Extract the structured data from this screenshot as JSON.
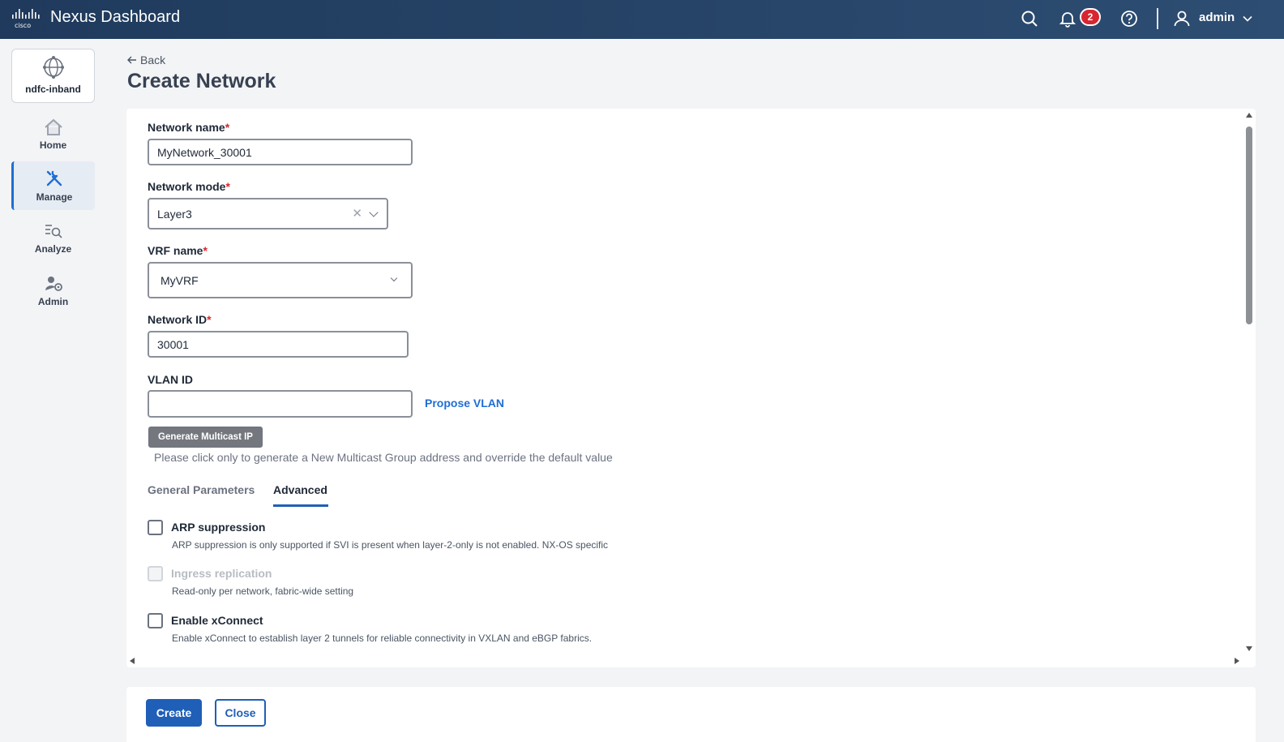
{
  "app": {
    "title": "Nexus Dashboard",
    "notification_count": "2",
    "user": "admin"
  },
  "sidebar": {
    "site": "ndfc-inband",
    "items": [
      {
        "label": "Home",
        "icon": "home-icon"
      },
      {
        "label": "Manage",
        "icon": "wrench-icon",
        "active": true
      },
      {
        "label": "Analyze",
        "icon": "analyze-icon"
      },
      {
        "label": "Admin",
        "icon": "admin-icon"
      }
    ]
  },
  "header": {
    "back_label": "Back",
    "title": "Create Network"
  },
  "form": {
    "network_name": {
      "label": "Network name",
      "required": "*",
      "value": "MyNetwork_30001"
    },
    "network_mode": {
      "label": "Network mode",
      "required": "*",
      "value": "Layer3"
    },
    "vrf_name": {
      "label": "VRF name",
      "required": "*",
      "value": "MyVRF"
    },
    "network_id": {
      "label": "Network ID",
      "required": "*",
      "value": "30001"
    },
    "vlan_id": {
      "label": "VLAN ID",
      "value": "",
      "propose_label": "Propose VLAN"
    },
    "generate_multicast_label": "Generate Multicast IP",
    "generate_multicast_hint": "Please click only to generate a New Multicast Group address and override the default value",
    "tabs": [
      {
        "label": "General Parameters"
      },
      {
        "label": "Advanced",
        "active": true
      }
    ],
    "advanced": [
      {
        "label": "ARP suppression",
        "description": "ARP suppression is only supported if SVI is present when layer-2-only is not enabled. NX-OS specific",
        "checked": false,
        "disabled": false
      },
      {
        "label": "Ingress replication",
        "description": "Read-only per network, fabric-wide setting",
        "checked": false,
        "disabled": true
      },
      {
        "label": "Enable xConnect",
        "description": "Enable xConnect to establish layer 2 tunnels for reliable connectivity in VXLAN and eBGP fabrics.",
        "checked": false,
        "disabled": false
      }
    ]
  },
  "footer": {
    "create_label": "Create",
    "close_label": "Close"
  },
  "colors": {
    "topbar": "#1f3a5c",
    "accent": "#1f5fb8",
    "required": "#d7262f",
    "badge": "#d7262f"
  }
}
